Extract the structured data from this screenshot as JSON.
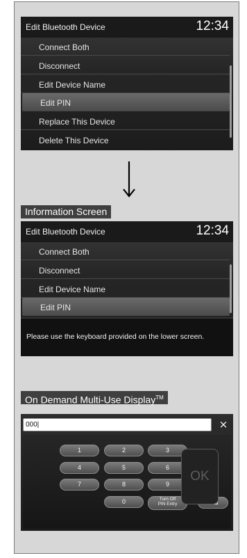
{
  "screen1": {
    "title": "Edit Bluetooth Device",
    "time": "12:34",
    "items": [
      {
        "label": "Connect Both"
      },
      {
        "label": "Disconnect"
      },
      {
        "label": "Edit Device Name"
      },
      {
        "label": "Edit PIN",
        "selected": true
      },
      {
        "label": "Replace This Device"
      },
      {
        "label": "Delete This Device"
      }
    ]
  },
  "label_info": "Information Screen",
  "screen2": {
    "title": "Edit Bluetooth Device",
    "time": "12:34",
    "items": [
      {
        "label": "Connect Both"
      },
      {
        "label": "Disconnect"
      },
      {
        "label": "Edit Device Name"
      },
      {
        "label": "Edit PIN",
        "selected": true
      }
    ],
    "message": "Please use the keyboard provided on the lower screen."
  },
  "label_odmd": "On Demand Multi-Use Display",
  "label_odmd_tm": "TM",
  "keypad": {
    "input_value": "000|",
    "close": "×",
    "keys": [
      "1",
      "2",
      "3",
      "4",
      "5",
      "6",
      "7",
      "8",
      "9",
      "0"
    ],
    "turn_off_pin": "Turn Off\nPIN Entry",
    "backspace": "⌫",
    "ok": "OK"
  },
  "colors": {
    "panel": "#d7d7d7",
    "screen_bg": "#1c1c1c",
    "tag_bg": "#3f3f3f",
    "selected": "#5a5a5a"
  }
}
